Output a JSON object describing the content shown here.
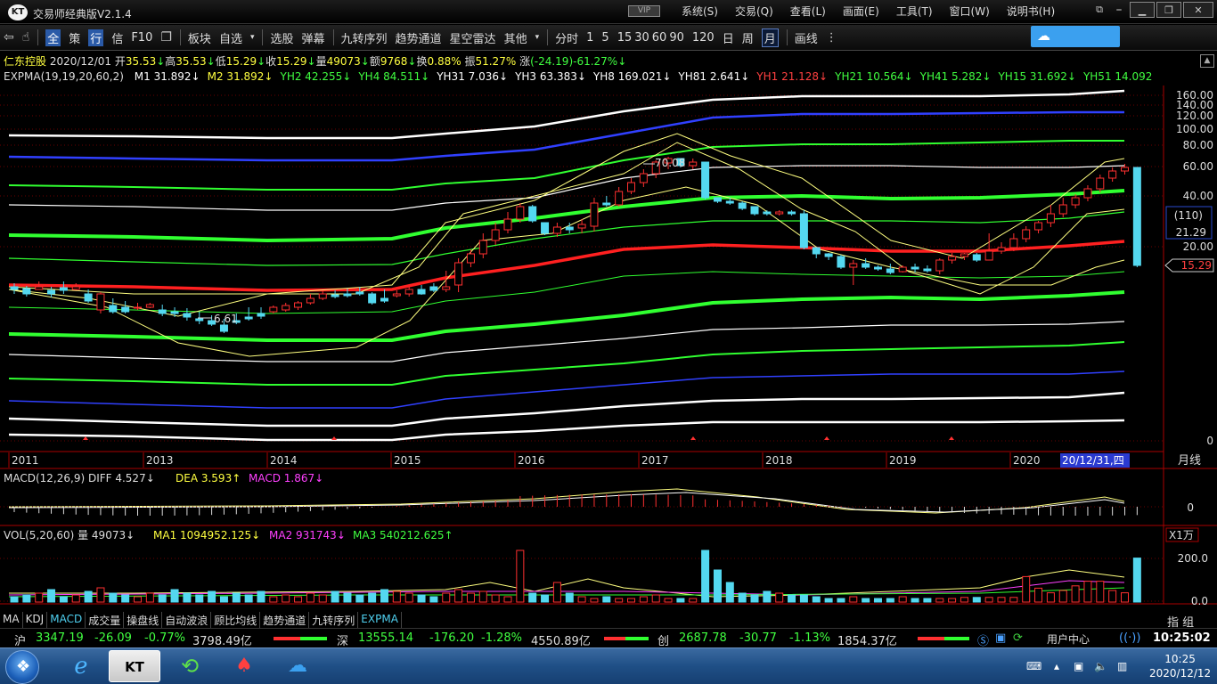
{
  "window": {
    "logo": "KT",
    "title": "交易师经典版V2.1.4",
    "vip": "VIP"
  },
  "menu": [
    "系统(S)",
    "交易(Q)",
    "查看(L)",
    "画面(E)",
    "工具(T)",
    "窗口(W)",
    "说明书(H)"
  ],
  "toolbar": {
    "icons": [
      "back-arrow-icon",
      "hand-icon"
    ],
    "items": [
      "全",
      "策",
      "行",
      "信",
      "F10",
      "板块",
      "自选",
      "选股",
      "弹幕",
      "九转序列",
      "趋势通道",
      "星空雷达",
      "其他",
      "分时",
      "1",
      "5",
      "15",
      "30",
      "60",
      "90",
      "120",
      "日",
      "周",
      "月",
      "画线"
    ]
  },
  "quote": {
    "name": "仁东控股",
    "date": "2020/12/01",
    "open_label": "开",
    "open": "35.53",
    "high_label": "高",
    "high": "35.53",
    "low_label": "低",
    "low": "15.29",
    "close_label": "收",
    "close": "15.29",
    "vol_label": "量",
    "vol": "49073",
    "amt_label": "额",
    "amt": "9768",
    "turn_label": "换",
    "turn": "0.88%",
    "amp_label": "振",
    "amp": "51.27%",
    "chg_label": "涨",
    "chg": "(-24.19)-61.27%"
  },
  "expma": {
    "label": "EXPMA(19,19,20,60,2)",
    "items": [
      {
        "name": "M1",
        "value": "31.892↓",
        "color": "#ffffff"
      },
      {
        "name": "M2",
        "value": "31.892↓",
        "color": "#ffff40"
      },
      {
        "name": "YH2",
        "value": "42.255↓",
        "color": "#40ff40"
      },
      {
        "name": "YH4",
        "value": "84.511↓",
        "color": "#40ff40"
      },
      {
        "name": "YH31",
        "value": "7.036↓",
        "color": "#ffffff"
      },
      {
        "name": "YH3",
        "value": "63.383↓",
        "color": "#ffffff"
      },
      {
        "name": "YH8",
        "value": "169.021↓",
        "color": "#ffffff"
      },
      {
        "name": "YH81",
        "value": "2.641↓",
        "color": "#ffffff"
      },
      {
        "name": "YH1",
        "value": "21.128↓",
        "color": "#ff4040"
      },
      {
        "name": "YH21",
        "value": "10.564↓",
        "color": "#40ff40"
      },
      {
        "name": "YH41",
        "value": "5.282↓",
        "color": "#40ff40"
      },
      {
        "name": "YH15",
        "value": "31.692↓",
        "color": "#40ff40"
      },
      {
        "name": "YH51",
        "value": "14.092",
        "color": "#40ff40"
      }
    ]
  },
  "price_axis": [
    "160.00",
    "140.00",
    "120.00",
    "100.00",
    "80.00",
    "60.00",
    "40.00",
    "20.00",
    "0"
  ],
  "price_markers": {
    "level": "(110)",
    "ref": "21.29",
    "last": "15.29"
  },
  "annotations": {
    "high": "70.08",
    "low": "6.61"
  },
  "years": [
    "2011",
    "2013",
    "2014",
    "2015",
    "2016",
    "2017",
    "2018",
    "2019",
    "2020"
  ],
  "date_cursor": "20/12/31,四",
  "period": "月线",
  "macd": {
    "label": "MACD(12,26,9)",
    "diff_label": "DIFF",
    "diff": "4.527↓",
    "dea_label": "DEA",
    "dea": "3.593↑",
    "macd_label": "MACD",
    "macd": "1.867↓",
    "axis": "0"
  },
  "vol": {
    "label": "VOL(5,20,60)",
    "vol_label": "量",
    "vol": "49073↓",
    "ma1_label": "MA1",
    "ma1": "1094952.125↓",
    "ma2_label": "MA2",
    "ma2": "931743↓",
    "ma3_label": "MA3",
    "ma3": "540212.625↑",
    "unit": "X1万",
    "axis": [
      "200.0",
      "0.0"
    ]
  },
  "bottom_tabs": [
    "MA",
    "KDJ",
    "MACD",
    "成交量",
    "操盘线",
    "自动波浪",
    "顾比均线",
    "趋势通道",
    "九转序列",
    "EXPMA"
  ],
  "bottom_right": "指  组",
  "indices": [
    {
      "name": "沪",
      "value": "3347.19",
      "chg": "-26.09",
      "pct": "-0.77%",
      "amt": "3798.49亿"
    },
    {
      "name": "深",
      "value": "13555.14",
      "chg": "-176.20",
      "pct": "-1.28%",
      "amt": "4550.89亿"
    },
    {
      "name": "创",
      "value": "2687.78",
      "chg": "-30.77",
      "pct": "-1.13%",
      "amt": "1854.37亿"
    }
  ],
  "status_right": {
    "user_center": "用户中心",
    "time": "10:25:02"
  },
  "taskbar": {
    "time": "10:25",
    "date": "2020/12/12"
  },
  "colors": {
    "up": "#ff4040",
    "down": "#40ff40",
    "white": "#ffffff",
    "red_line": "#ff2020",
    "green_line": "#30ff30",
    "blue_line": "#2020ff",
    "cyan": "#54d8f0"
  }
}
